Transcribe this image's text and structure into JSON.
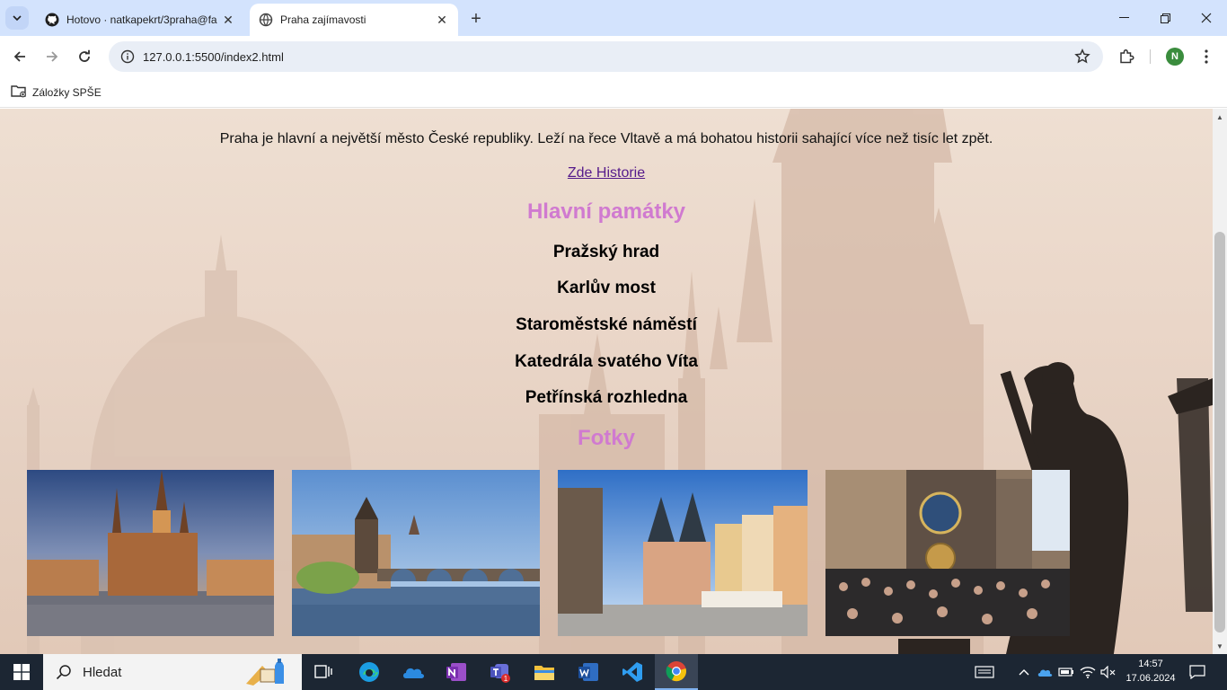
{
  "browser": {
    "tabs": [
      {
        "title": "Hotovo · natkapekrt/3praha@fa",
        "favicon": "github-icon",
        "active": false
      },
      {
        "title": "Praha zajímavosti",
        "favicon": "globe-icon",
        "active": true
      }
    ],
    "url": "127.0.0.1:5500/index2.html",
    "profile_initial": "N",
    "bookmarks": [
      {
        "label": "Záložky SPŠE",
        "icon": "folder-icon"
      }
    ]
  },
  "page": {
    "intro": "Praha je hlavní a největší město České republiky. Leží na řece Vltavě a má bohatou historii sahající více než tisíc let zpět.",
    "history_link": "Zde Historie",
    "landmarks_heading": "Hlavní památky",
    "landmarks": [
      "Pražský hrad",
      "Karlův most",
      "Staroměstské náměstí",
      "Katedrála svatého Víta",
      "Petřínská rozhledna"
    ],
    "photos_heading": "Fotky",
    "photos": [
      {
        "subject": "prague-castle-photo"
      },
      {
        "subject": "charles-bridge-photo"
      },
      {
        "subject": "old-town-square-photo"
      },
      {
        "subject": "astronomical-clock-photo"
      }
    ],
    "heading_color": "#d07ad0",
    "link_color": "#551a8b"
  },
  "taskbar": {
    "search_label": "Hledat",
    "time": "14:57",
    "date": "17.06.2024"
  }
}
